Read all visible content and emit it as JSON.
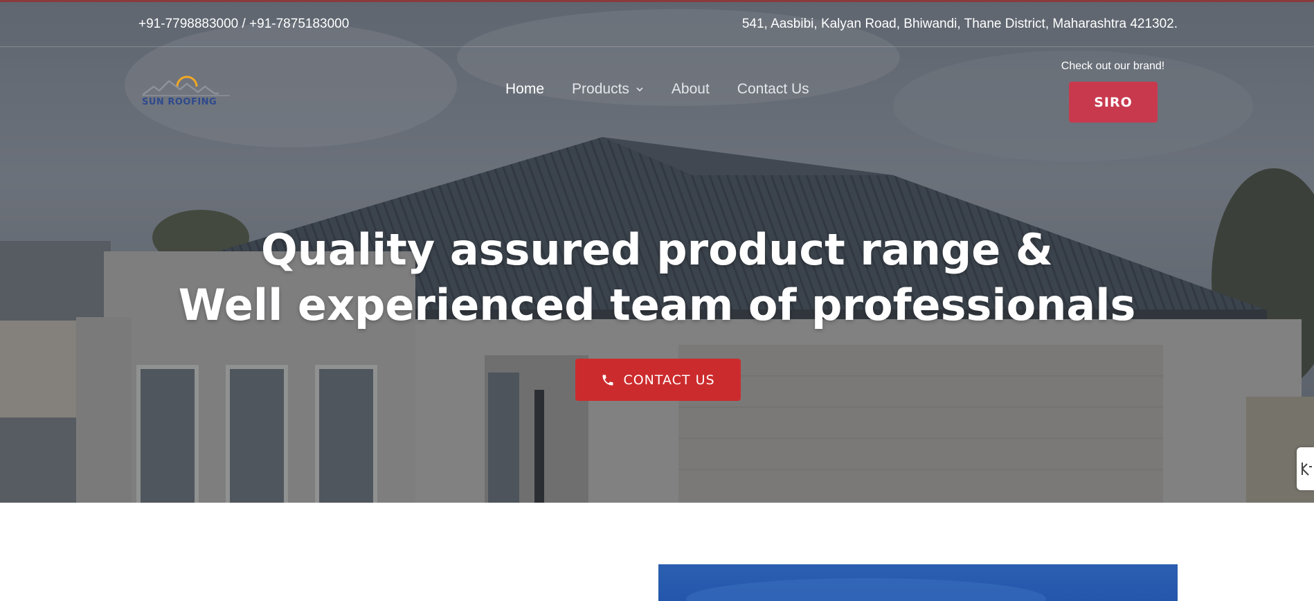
{
  "topbar": {
    "phone": "+91-7798883000 / +91-7875183000",
    "address": "541, Aasbibi, Kalyan Road, Bhiwandi, Thane District, Maharashtra 421302."
  },
  "logo": {
    "text": "SUN ROOFING",
    "sun_color": "#f0a826",
    "roof_color": "#8d929a",
    "text_color": "#2e4a8c"
  },
  "nav": {
    "items": [
      {
        "label": "Home",
        "active": true
      },
      {
        "label": "Products",
        "has_dropdown": true
      },
      {
        "label": "About"
      },
      {
        "label": "Contact Us"
      }
    ]
  },
  "brand_cta": {
    "caption": "Check out our brand!",
    "button_label": "SIRO",
    "button_color": "#c8394e"
  },
  "hero": {
    "headline_line1": "Quality assured product range &",
    "headline_line2": "Well experienced team of professionals",
    "cta_label": "CONTACT US",
    "cta_icon": "phone-icon",
    "cta_color": "#cc2b2d"
  },
  "side_tab": {
    "icon": "accessibility-icon"
  }
}
